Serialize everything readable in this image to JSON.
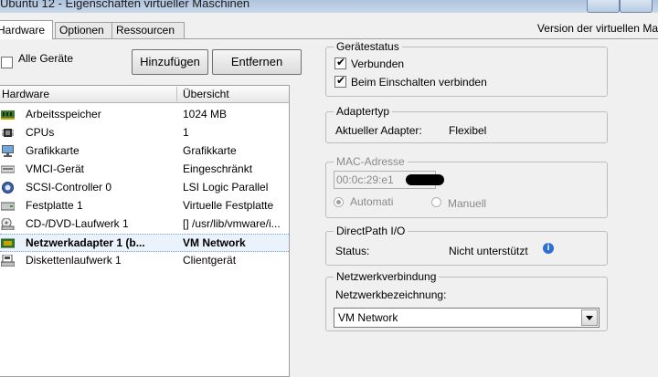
{
  "window": {
    "title": "Ubuntu 12 - Eigenschaften virtueller Maschinen"
  },
  "tabs": [
    {
      "label": "Hardware",
      "active": true
    },
    {
      "label": "Optionen",
      "active": false
    },
    {
      "label": "Ressourcen",
      "active": false
    }
  ],
  "version_label": "Version der virtuellen Ma",
  "left": {
    "show_all_label": "Alle Geräte",
    "show_all_checked": false,
    "add_button": "Hinzufügen",
    "remove_button": "Entfernen",
    "columns": [
      "Hardware",
      "Übersicht"
    ],
    "rows": [
      {
        "icon": "memory-icon",
        "name": "Arbeitsspeicher",
        "summary": "1024 MB",
        "selected": false
      },
      {
        "icon": "cpu-icon",
        "name": "CPUs",
        "summary": "1",
        "selected": false
      },
      {
        "icon": "monitor-icon",
        "name": "Grafikkarte",
        "summary": "Grafikkarte",
        "selected": false
      },
      {
        "icon": "vmci-device-icon",
        "name": "VMCI-Gerät",
        "summary": "Eingeschränkt",
        "selected": false
      },
      {
        "icon": "scsi-controller-icon",
        "name": "SCSI-Controller 0",
        "summary": "LSI Logic Parallel",
        "selected": false
      },
      {
        "icon": "hard-disk-icon",
        "name": "Festplatte 1",
        "summary": "Virtuelle Festplatte",
        "selected": false
      },
      {
        "icon": "cd-dvd-drive-icon",
        "name": "CD-/DVD-Laufwerk 1",
        "summary": "[] /usr/lib/vmware/i...",
        "selected": false
      },
      {
        "icon": "network-adapter-icon",
        "name": "Netzwerkadapter 1 (b...",
        "summary": "VM Network",
        "selected": true
      },
      {
        "icon": "floppy-drive-icon",
        "name": "Diskettenlaufwerk 1",
        "summary": "Clientgerät",
        "selected": false
      }
    ]
  },
  "device_status": {
    "legend": "Gerätestatus",
    "connected_label": "Verbunden",
    "connected_checked": true,
    "connect_on_power_label": "Beim Einschalten verbinden",
    "connect_on_power_checked": true
  },
  "adapter_type": {
    "legend": "Adaptertyp",
    "label": "Aktueller Adapter:",
    "value": "Flexibel"
  },
  "mac": {
    "legend": "MAC-Adresse",
    "value": "00:0c:29:e1",
    "auto_label": "Automati",
    "manual_label": "Manuell",
    "mode": "auto"
  },
  "directpath": {
    "legend": "DirectPath I/O",
    "status_label": "Status:",
    "status_value": "Nicht unterstützt",
    "info_glyph": "i"
  },
  "network": {
    "legend": "Netzwerkverbindung",
    "label": "Netzwerkbezeichnung:",
    "selected": "VM Network"
  },
  "checkmark_glyph": "✔"
}
